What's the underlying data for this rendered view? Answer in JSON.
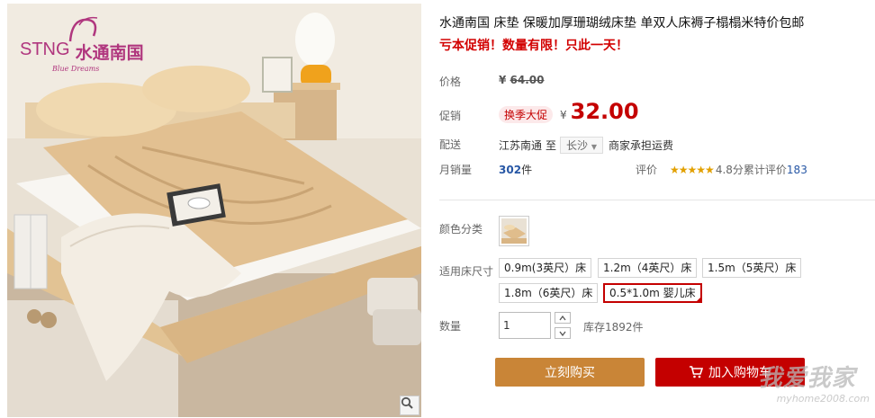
{
  "brand": {
    "logo_text": "STNG",
    "logo_cn": "水通南国",
    "logo_script": "Blue Dreams"
  },
  "product": {
    "title": "水通南国 床垫 保暖加厚珊瑚绒床垫 单双人床褥子榻榻米特价包邮",
    "promo_line": "亏本促销！数量有限！只此一天！"
  },
  "price": {
    "label": "价格",
    "currency": "¥",
    "original": "64.00"
  },
  "promotion": {
    "label": "促销",
    "badge": "换季大促",
    "currency": "¥",
    "price": "32.00"
  },
  "shipping": {
    "label": "配送",
    "from": "江苏南通",
    "to_word": "至",
    "destination": "长沙",
    "fee_text": "商家承担运费"
  },
  "sales": {
    "label": "月销量",
    "count": "302",
    "unit": "件"
  },
  "rating": {
    "label": "评价",
    "stars": "★★★★★",
    "score_text": "4.8分",
    "count_label": "累计评价",
    "count": "183"
  },
  "color": {
    "label": "颜色分类"
  },
  "size": {
    "label": "适用床尺寸",
    "options": [
      "0.9m(3英尺）床",
      "1.2m（4英尺）床",
      "1.5m（5英尺）床",
      "1.8m（6英尺）床",
      "0.5*1.0m 婴儿床"
    ],
    "selected_index": 4
  },
  "quantity": {
    "label": "数量",
    "value": "1",
    "stock_text": "库存1892件"
  },
  "actions": {
    "buy_now": "立刻购买",
    "add_to_cart": "加入购物车"
  },
  "watermark": {
    "text": "我爱我家",
    "url": "myhome2008.com"
  },
  "colors": {
    "price_red": "#c40000",
    "buy_orange": "#c98537",
    "brand_magenta": "#b0367e"
  }
}
